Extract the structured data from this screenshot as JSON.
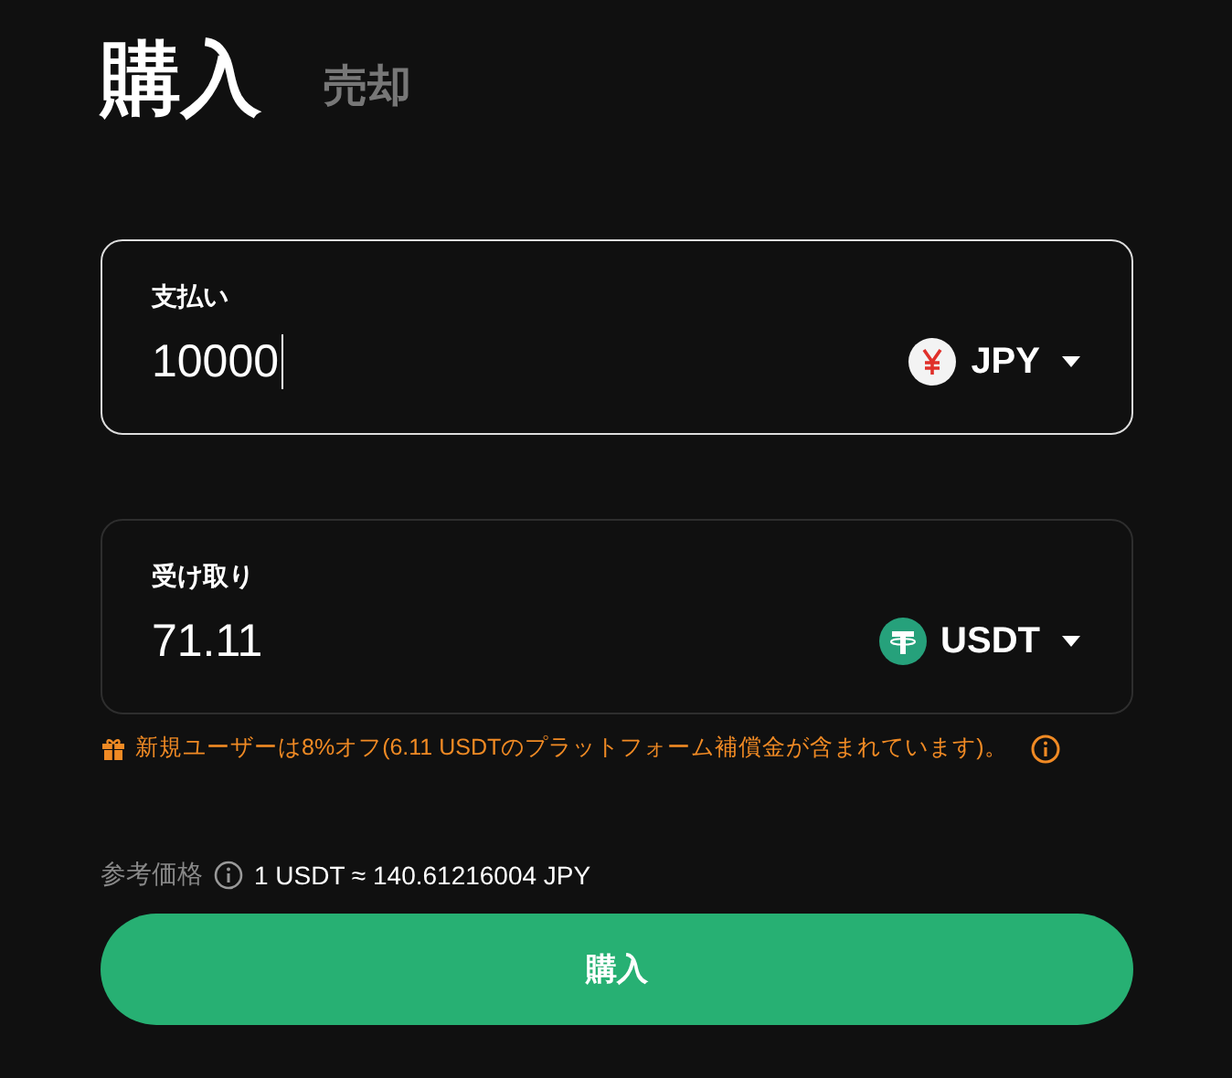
{
  "tabs": [
    {
      "label": "購入",
      "selected": true
    },
    {
      "label": "売却",
      "selected": false
    }
  ],
  "fields": [
    {
      "label": "支払い",
      "value": "10000",
      "focused": true,
      "currency": {
        "kind": "yen",
        "code": "JPY"
      }
    },
    {
      "label": "受け取り",
      "value": "71.11",
      "focused": false,
      "currency": {
        "kind": "tether",
        "code": "USDT"
      }
    }
  ],
  "promo": "新規ユーザーは8%オフ(6.11 USDTのプラットフォーム補償金が含まれています)。",
  "reference": {
    "label": "参考価格",
    "rate": "1 USDT ≈ 140.61216004 JPY"
  },
  "submit": "購入"
}
